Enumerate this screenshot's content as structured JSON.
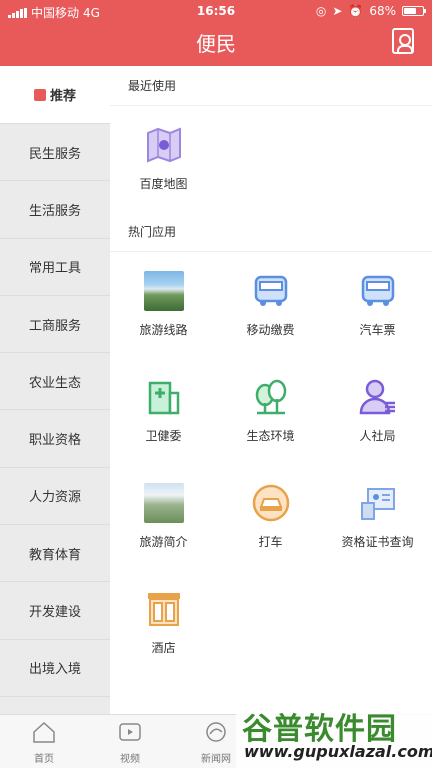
{
  "status_bar": {
    "carrier": "中国移动",
    "network": "4G",
    "time": "16:56",
    "battery": "68%",
    "battery_level": 0.68
  },
  "header": {
    "title": "便民"
  },
  "sidebar": {
    "items": [
      {
        "label": "推荐",
        "active": true
      },
      {
        "label": "民生服务"
      },
      {
        "label": "生活服务"
      },
      {
        "label": "常用工具"
      },
      {
        "label": "工商服务"
      },
      {
        "label": "农业生态"
      },
      {
        "label": "职业资格"
      },
      {
        "label": "人力资源"
      },
      {
        "label": "教育体育"
      },
      {
        "label": "开发建设"
      },
      {
        "label": "出境入境"
      }
    ]
  },
  "recent": {
    "title": "最近使用",
    "items": [
      {
        "label": "百度地图",
        "icon": "map-icon"
      }
    ]
  },
  "hot": {
    "title": "热门应用",
    "items": [
      {
        "label": "旅游线路",
        "icon": "mountain-photo-icon"
      },
      {
        "label": "移动缴费",
        "icon": "bus-icon"
      },
      {
        "label": "汽车票",
        "icon": "bus-icon"
      },
      {
        "label": "卫健委",
        "icon": "hospital-icon"
      },
      {
        "label": "生态环境",
        "icon": "trees-icon"
      },
      {
        "label": "人社局",
        "icon": "person-icon"
      },
      {
        "label": "旅游简介",
        "icon": "landscape-photo-icon"
      },
      {
        "label": "打车",
        "icon": "taxi-icon"
      },
      {
        "label": "资格证书查询",
        "icon": "certificate-icon"
      },
      {
        "label": "酒店",
        "icon": "hotel-icon"
      }
    ]
  },
  "tabbar": {
    "items": [
      {
        "label": "首页"
      },
      {
        "label": "视频"
      },
      {
        "label": "新闻网"
      }
    ]
  },
  "watermark": {
    "line1": "谷普软件园",
    "line2": "www.gupuxlazal.com"
  },
  "colors": {
    "brand": "#e85a5a",
    "sidebar_bg": "#ebebeb",
    "icon_blue": "#5b8fe0",
    "icon_green": "#3fae6a",
    "icon_orange": "#e8a24a",
    "icon_purple": "#7a5cd6"
  }
}
